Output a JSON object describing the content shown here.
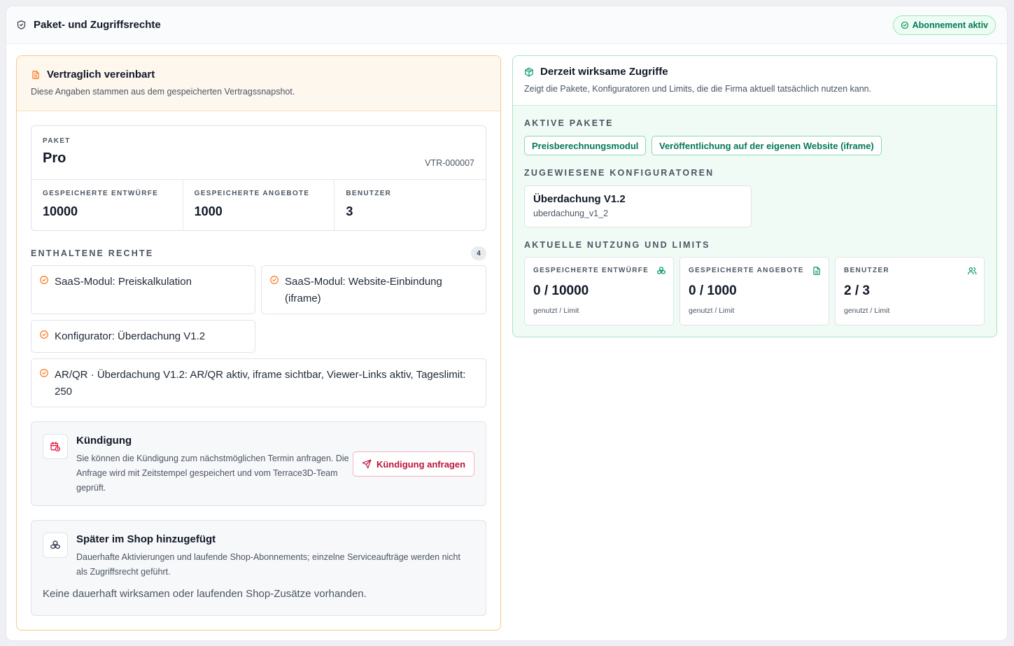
{
  "header": {
    "title": "Paket- und Zugriffsrechte",
    "status_badge": "Abonnement aktiv",
    "title_icon": "shield-check-icon"
  },
  "contract": {
    "title": "Vertraglich vereinbart",
    "subtitle": "Diese Angaben stammen aus dem gespeicherten Vertragssnapshot.",
    "package_label": "PAKET",
    "package_name": "Pro",
    "contract_id": "VTR-000007",
    "stats": [
      {
        "label": "GESPEICHERTE ENTWÜRFE",
        "value": "10000"
      },
      {
        "label": "GESPEICHERTE ANGEBOTE",
        "value": "1000"
      },
      {
        "label": "BENUTZER",
        "value": "3"
      }
    ],
    "rights_heading": "ENTHALTENE RECHTE",
    "rights_count": "4",
    "rights": [
      "SaaS-Modul: Preiskalkulation",
      "SaaS-Modul: Website-Einbindung (iframe)",
      "Konfigurator: Überdachung V1.2",
      "AR/QR · Überdachung V1.2: AR/QR aktiv, iframe sichtbar, Viewer-Links aktiv, Tageslimit: 250"
    ]
  },
  "cancellation": {
    "title": "Kündigung",
    "text": "Sie können die Kündigung zum nächstmöglichen Termin anfragen. Die Anfrage wird mit Zeitstempel gespeichert und vom Terrace3D-Team geprüft.",
    "button_label": "Kündigung anfragen"
  },
  "shop": {
    "title": "Später im Shop hinzugefügt",
    "text": "Dauerhafte Aktivierungen und laufende Shop-Abonnements; einzelne Serviceaufträge werden nicht als Zugriffsrecht geführt.",
    "empty": "Keine dauerhaft wirksamen oder laufenden Shop-Zusätze vorhanden."
  },
  "access": {
    "title": "Derzeit wirksame Zugriffe",
    "subtitle": "Zeigt die Pakete, Konfiguratoren und Limits, die die Firma aktuell tatsächlich nutzen kann.",
    "packages_heading": "AKTIVE PAKETE",
    "packages": [
      "Preisberechnungsmodul",
      "Veröffentlichung auf der eigenen Website (iframe)"
    ],
    "configurators_heading": "ZUGEWIESENE KONFIGURATOREN",
    "configurator": {
      "name": "Überdachung V1.2",
      "code": "uberdachung_v1_2"
    },
    "usage_heading": "AKTUELLE NUTZUNG UND LIMITS",
    "usage": [
      {
        "label": "GESPEICHERTE ENTWÜRFE",
        "value": "0 / 10000",
        "hint": "genutzt / Limit",
        "icon": "boxes-icon"
      },
      {
        "label": "GESPEICHERTE ANGEBOTE",
        "value": "0 / 1000",
        "hint": "genutzt / Limit",
        "icon": "document-icon"
      },
      {
        "label": "BENUTZER",
        "value": "2 / 3",
        "hint": "genutzt / Limit",
        "icon": "users-icon"
      }
    ]
  },
  "colors": {
    "accent_orange": "#f97316",
    "accent_green": "#059669",
    "danger": "#be123c"
  }
}
